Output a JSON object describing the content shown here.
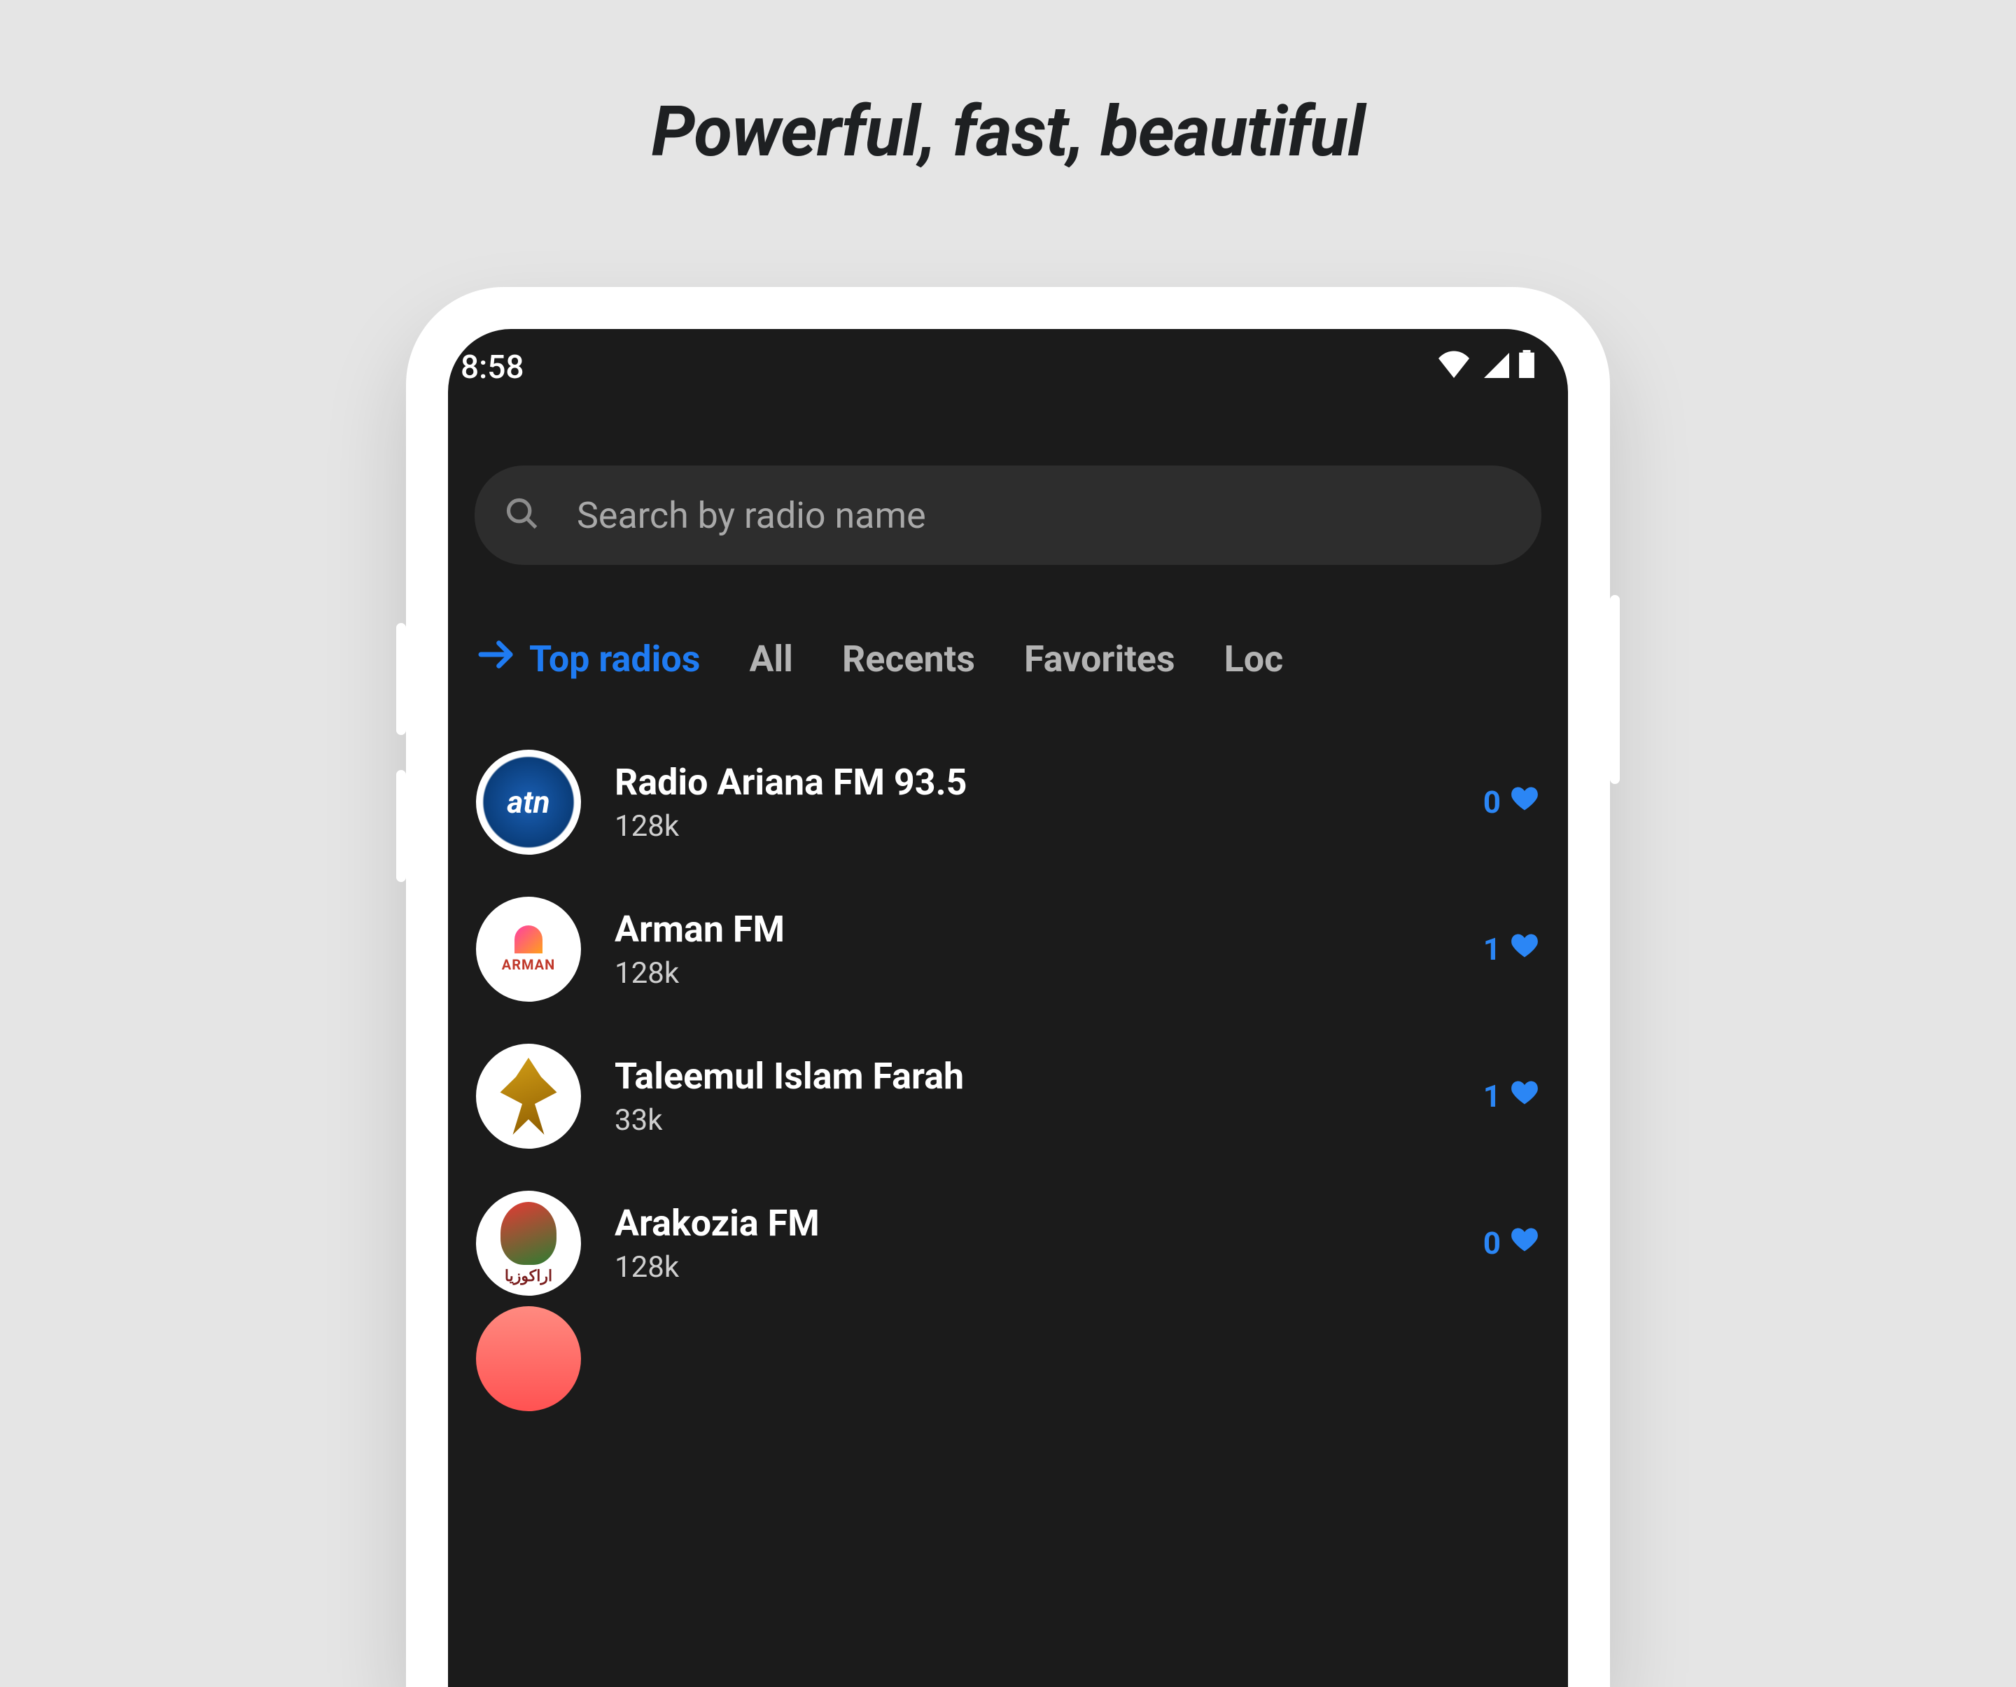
{
  "tagline": "Powerful,  fast, beautiful",
  "status": {
    "time": "8:58"
  },
  "search": {
    "placeholder": "Search by radio name"
  },
  "tabs": [
    "Top radios",
    "All",
    "Recents",
    "Favorites",
    "Loc"
  ],
  "active_tab_index": 0,
  "stations": [
    {
      "name": "Radio Ariana FM 93.5",
      "bitrate": "128k",
      "likes": "0"
    },
    {
      "name": "Arman FM",
      "bitrate": "128k",
      "likes": "1"
    },
    {
      "name": "Taleemul Islam Farah",
      "bitrate": "33k",
      "likes": "1"
    },
    {
      "name": "Arakozia FM",
      "bitrate": "128k",
      "likes": "0"
    }
  ]
}
